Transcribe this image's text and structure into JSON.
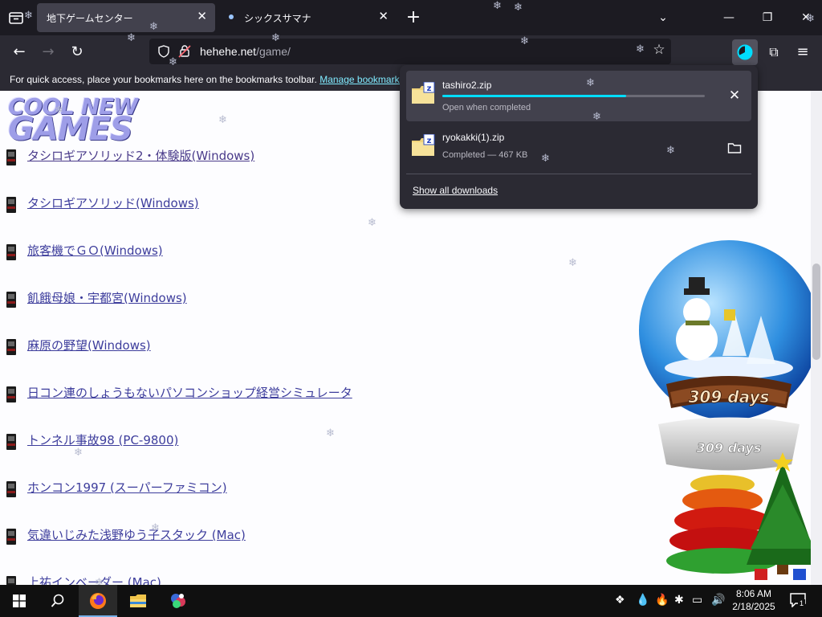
{
  "tabs": [
    {
      "label": "地下ゲームセンター",
      "active": true
    },
    {
      "label": "シックスサマナ",
      "active": false
    }
  ],
  "navbar": {
    "url_host": "hehehe.net",
    "url_path": "/game/"
  },
  "bookmarks_bar": {
    "message": "For quick access, place your bookmarks here on the bookmarks toolbar.",
    "link": "Manage bookmarks…"
  },
  "page": {
    "logo_line1": "COOL NEW",
    "logo_line2": "GAMES",
    "games": [
      "タシロギアソリッド2・体験版(Windows)",
      "タシロギアソリッド(Windows)",
      "旅客機でＧＯ(Windows)",
      "飢餓母娘・宇都宮(Windows)",
      "麻原の野望(Windows)",
      "日コン連のしょうもないパソコンショップ経営シミュレータ",
      "トンネル事故98 (PC-9800)",
      "ホンコン1997 (スーパーファミコン)",
      "気違いじみた浅野ゆう子スタック (Mac)",
      "上祐インベーダー (Mac)"
    ],
    "snowglobe_text": "309 days",
    "snowglobe_base_text": "309 days"
  },
  "downloads": {
    "items": [
      {
        "name": "tashiro2.zip",
        "status": "Open when completed",
        "progress": 0.7,
        "action": "cancel"
      },
      {
        "name": "ryokakki(1).zip",
        "status": "Completed — 467 KB",
        "action": "show-in-folder"
      }
    ],
    "show_all": "Show all downloads"
  },
  "taskbar": {
    "time": "8:06 AM",
    "date": "2/18/2025",
    "notification_count": "1"
  },
  "colors": {
    "tabstrip": "#1c1b22",
    "toolbar": "#2b2a33",
    "accent": "#00ddff",
    "link": "#3d3d9c"
  }
}
